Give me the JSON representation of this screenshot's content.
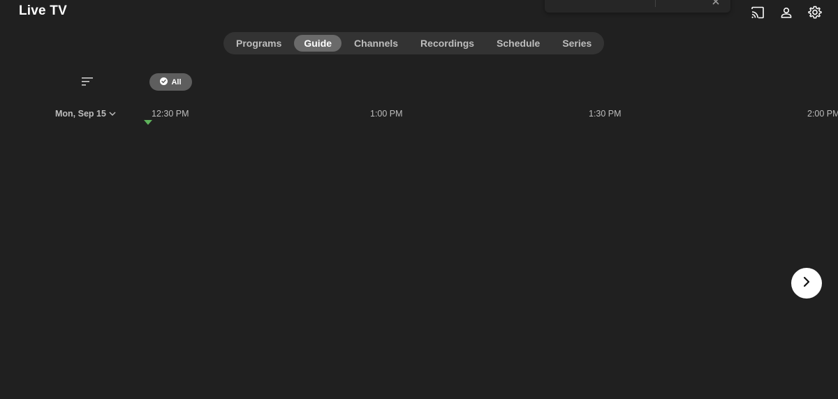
{
  "header": {
    "title": "Live TV",
    "actions": [
      {
        "icon": "cast-icon"
      },
      {
        "icon": "user-icon"
      },
      {
        "icon": "gear-icon"
      }
    ]
  },
  "tabs": [
    {
      "label": "Programs",
      "active": false
    },
    {
      "label": "Guide",
      "active": true
    },
    {
      "label": "Channels",
      "active": false
    },
    {
      "label": "Recordings",
      "active": false
    },
    {
      "label": "Schedule",
      "active": false
    },
    {
      "label": "Series",
      "active": false
    }
  ],
  "filters": {
    "all_label": "All",
    "sort_icon": "sort-icon",
    "check_icon": "check-circle-icon"
  },
  "guide": {
    "date_label": "Mon, Sep 15",
    "times": [
      "12:30 PM",
      "1:00 PM",
      "1:30 PM",
      "2:00 PM"
    ],
    "now_marker_color": "#5fb35c"
  },
  "navigation": {
    "next_icon": "chevron-right-icon"
  }
}
